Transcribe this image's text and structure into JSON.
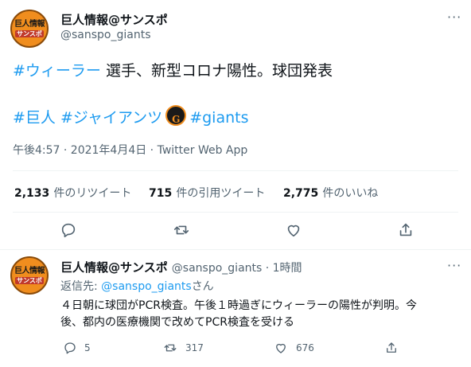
{
  "main_tweet": {
    "avatar": {
      "line1": "巨人情報",
      "line2": "サンスポ"
    },
    "display_name": "巨人情報@サンスポ",
    "handle": "@sanspo_giants",
    "text_hashtag1": "#ウィーラー",
    "text_body": " 選手、新型コロナ陽性。球団発表",
    "hashtags_line": [
      "#巨人",
      "#ジャイアンツ",
      "#giants"
    ],
    "emoji": "giants-logo",
    "timestamp": "午後4:57 · 2021年4月4日 · Twitter Web App",
    "stats": [
      {
        "value": "2,133",
        "label": "件のリツイート"
      },
      {
        "value": "715",
        "label": "件の引用ツイート"
      },
      {
        "value": "2,775",
        "label": "件のいいね"
      }
    ]
  },
  "reply_tweet": {
    "avatar": {
      "line1": "巨人情報",
      "line2": "サンスポ"
    },
    "display_name": "巨人情報@サンスポ",
    "handle_time": "@sanspo_giants · 1時間",
    "reply_prefix": "返信先: ",
    "reply_to": "@sanspo_giants",
    "reply_suffix": "さん",
    "body_line1": "４日朝に球団がPCR検査。午後１時過ぎにウィーラーの陽性が判明。今",
    "body_line2": "後、都内の医療機関で改めてPCR検査を受ける",
    "counts": {
      "reply": "5",
      "retweet": "317",
      "like": "676"
    }
  },
  "colors": {
    "accent": "#1d9bf0",
    "muted": "#536471",
    "text": "#0f1419"
  }
}
